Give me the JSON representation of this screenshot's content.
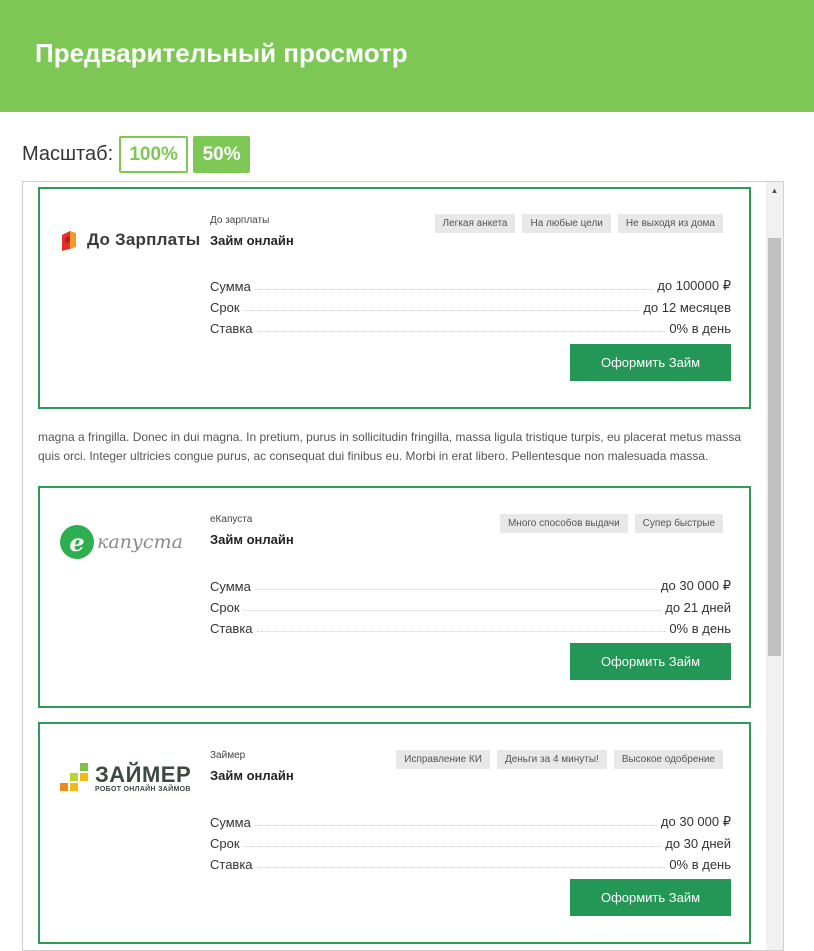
{
  "header": {
    "title": "Предварительный просмотр"
  },
  "scale": {
    "label": "Масштаб:",
    "options": [
      "100%",
      "50%"
    ]
  },
  "offers": [
    {
      "logo": {
        "icon": "dozarplaty-logo-icon",
        "text": "До Зарплаты"
      },
      "lender": "До зарплаты",
      "title": "Займ онлайн",
      "tags": [
        "Легкая анкета",
        "На любые цели",
        "Не выходя из дома"
      ],
      "details": [
        {
          "label": "Сумма",
          "value": "до 100000 ₽"
        },
        {
          "label": "Срок",
          "value": "до 12 месяцев"
        },
        {
          "label": "Ставка",
          "value": "0% в день"
        }
      ],
      "button": "Оформить Займ"
    },
    {
      "logo": {
        "icon": "ekapusta-logo-icon",
        "letter": "e",
        "text": "капуста"
      },
      "lender": "еКапуста",
      "title": "Займ онлайн",
      "tags": [
        "Много способов выдачи",
        "Супер быстрые"
      ],
      "details": [
        {
          "label": "Сумма",
          "value": "до 30 000 ₽"
        },
        {
          "label": "Срок",
          "value": "до 21 дней"
        },
        {
          "label": "Ставка",
          "value": "0% в день"
        }
      ],
      "button": "Оформить Займ"
    },
    {
      "logo": {
        "icon": "zaimer-logo-icon",
        "text": "ЗАЙМЕР",
        "subtext": "РОБОТ ОНЛАЙН ЗАЙМОВ"
      },
      "lender": "Займер",
      "title": "Займ онлайн",
      "tags": [
        "Исправление КИ",
        "Деньги за 4 минуты!",
        "Высокое одобрение"
      ],
      "details": [
        {
          "label": "Сумма",
          "value": "до 30 000 ₽"
        },
        {
          "label": "Срок",
          "value": "до 30 дней"
        },
        {
          "label": "Ставка",
          "value": "0% в день"
        }
      ],
      "button": "Оформить Займ"
    }
  ],
  "paragraph": "magna a fringilla. Donec in dui magna. In pretium, purus in sollicitudin fringilla, massa ligula tristique turpis, eu placerat metus massa quis orci. Integer ultricies congue purus, ac consequat dui finibus eu. Morbi in erat libero. Pellentesque non malesuada massa.",
  "colors": {
    "header": "#7dc855",
    "card_border": "#2f9a55",
    "button": "#249655"
  }
}
